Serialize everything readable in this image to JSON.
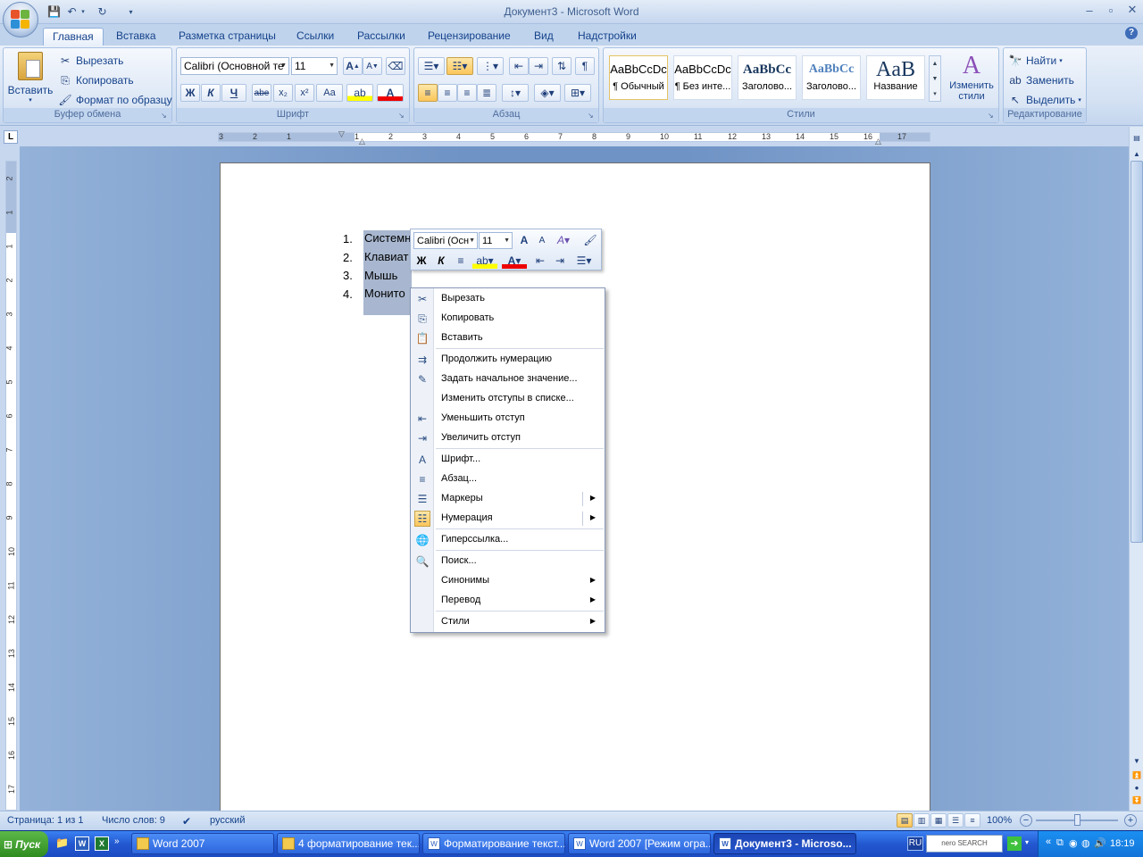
{
  "window": {
    "title": "Документ3 - Microsoft Word"
  },
  "tabs": [
    "Главная",
    "Вставка",
    "Разметка страницы",
    "Ссылки",
    "Рассылки",
    "Рецензирование",
    "Вид",
    "Надстройки"
  ],
  "clipboard": {
    "paste": "Вставить",
    "cut": "Вырезать",
    "copy": "Копировать",
    "format_painter": "Формат по образцу",
    "label": "Буфер обмена"
  },
  "font": {
    "name": "Calibri (Основной те",
    "size": "11",
    "label": "Шрифт",
    "bold": "Ж",
    "italic": "К",
    "underline": "Ч",
    "strike": "abe",
    "sub": "x₂",
    "sup": "x²",
    "case": "Aa"
  },
  "paragraph": {
    "label": "Абзац"
  },
  "styles": {
    "label": "Стили",
    "items": [
      {
        "preview": "AaBbCcDc",
        "name": "¶ Обычный"
      },
      {
        "preview": "AaBbCcDc",
        "name": "¶ Без инте..."
      },
      {
        "preview": "AaBbCc",
        "name": "Заголово..."
      },
      {
        "preview": "AaBbCc",
        "name": "Заголово..."
      },
      {
        "preview": "AaB",
        "name": "Название"
      }
    ],
    "change": "Изменить стили"
  },
  "editing": {
    "find": "Найти",
    "replace": "Заменить",
    "select": "Выделить",
    "label": "Редактирование"
  },
  "ruler_h": [
    "3",
    "2",
    "1",
    "1",
    "2",
    "3",
    "4",
    "5",
    "6",
    "7",
    "8",
    "9",
    "10",
    "11",
    "12",
    "13",
    "14",
    "15",
    "16",
    "17"
  ],
  "ruler_v": [
    "2",
    "1",
    "1",
    "2",
    "3",
    "4",
    "5",
    "6",
    "7",
    "8",
    "9",
    "10",
    "11",
    "12",
    "13",
    "14",
    "15",
    "16",
    "17"
  ],
  "document": {
    "list": [
      {
        "num": "1.",
        "text": "Системн"
      },
      {
        "num": "2.",
        "text": "Клавиат"
      },
      {
        "num": "3.",
        "text": "Мышь"
      },
      {
        "num": "4.",
        "text": "Монито"
      }
    ]
  },
  "mini_toolbar": {
    "font": "Calibri (Осн",
    "size": "11",
    "bold": "Ж",
    "italic": "К"
  },
  "context_menu": [
    {
      "label": "Вырезать",
      "icon": "scissors-icon",
      "glyph": "✂"
    },
    {
      "label": "Копировать",
      "icon": "copy-icon",
      "glyph": "⎘"
    },
    {
      "label": "Вставить",
      "icon": "paste-icon",
      "glyph": "📋"
    },
    {
      "label": "Продолжить нумерацию",
      "icon": "continue-numbering-icon",
      "glyph": "⇉"
    },
    {
      "label": "Задать начальное значение...",
      "icon": "set-value-icon",
      "glyph": "✎"
    },
    {
      "label": "Изменить отступы в списке...",
      "icon": "",
      "glyph": ""
    },
    {
      "label": "Уменьшить отступ",
      "icon": "decrease-indent-icon",
      "glyph": "⇤"
    },
    {
      "label": "Увеличить отступ",
      "icon": "increase-indent-icon",
      "glyph": "⇥"
    },
    {
      "label": "Шрифт...",
      "icon": "font-icon",
      "glyph": "A"
    },
    {
      "label": "Абзац...",
      "icon": "paragraph-icon",
      "glyph": "≡"
    },
    {
      "label": "Маркеры",
      "icon": "bullets-icon",
      "glyph": "☰"
    },
    {
      "label": "Нумерация",
      "icon": "numbering-icon",
      "glyph": "☷"
    },
    {
      "label": "Гиперссылка...",
      "icon": "hyperlink-icon",
      "glyph": "🌐"
    },
    {
      "label": "Поиск...",
      "icon": "research-icon",
      "glyph": "🔍"
    },
    {
      "label": "Синонимы",
      "icon": "",
      "glyph": ""
    },
    {
      "label": "Перевод",
      "icon": "",
      "glyph": ""
    },
    {
      "label": "Стили",
      "icon": "",
      "glyph": ""
    }
  ],
  "status": {
    "page": "Страница: 1 из 1",
    "words": "Число слов: 9",
    "lang": "русский",
    "zoom": "100%"
  },
  "taskbar": {
    "start": "Пуск",
    "tasks": [
      "Word 2007",
      "4 форматирование тек...",
      "Форматирование текст...",
      "Word 2007 [Режим огра...",
      "Документ3 - Microso..."
    ],
    "lang": "RU",
    "search": "nero SEARCH",
    "clock": "18:19"
  }
}
